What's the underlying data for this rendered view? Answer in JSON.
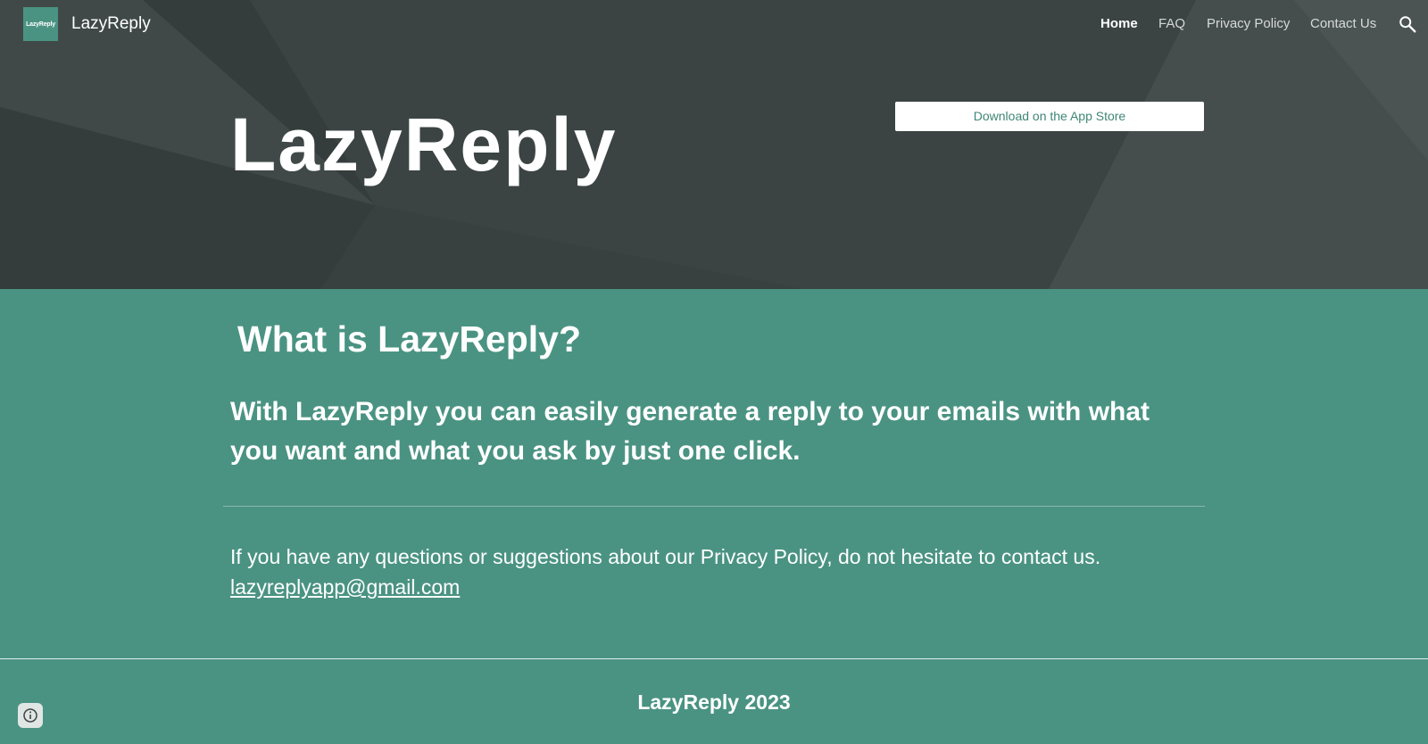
{
  "header": {
    "logo_text": "LazyReply",
    "site_name": "LazyReply",
    "nav": [
      {
        "label": "Home",
        "active": true
      },
      {
        "label": "FAQ",
        "active": false
      },
      {
        "label": "Privacy Policy",
        "active": false
      },
      {
        "label": "Contact Us",
        "active": false
      }
    ],
    "search_icon": "search-icon"
  },
  "hero": {
    "title": "LazyReply",
    "app_store_button": "Download on the App Store"
  },
  "main": {
    "heading": "What is LazyReply?",
    "lead": "With LazyReply you can easily generate a reply to your emails with what you want and what you ask by just one click.",
    "contact_text": "If you have any questions or suggestions about our Privacy Policy, do not hesitate to contact us.",
    "email": "lazyreplyapp@gmail.com"
  },
  "footer": {
    "text": "LazyReply 2023",
    "info_icon": "info-icon"
  },
  "colors": {
    "accent": "#4a9382",
    "hero_bg": "#3b4443",
    "text": "#ffffff"
  }
}
